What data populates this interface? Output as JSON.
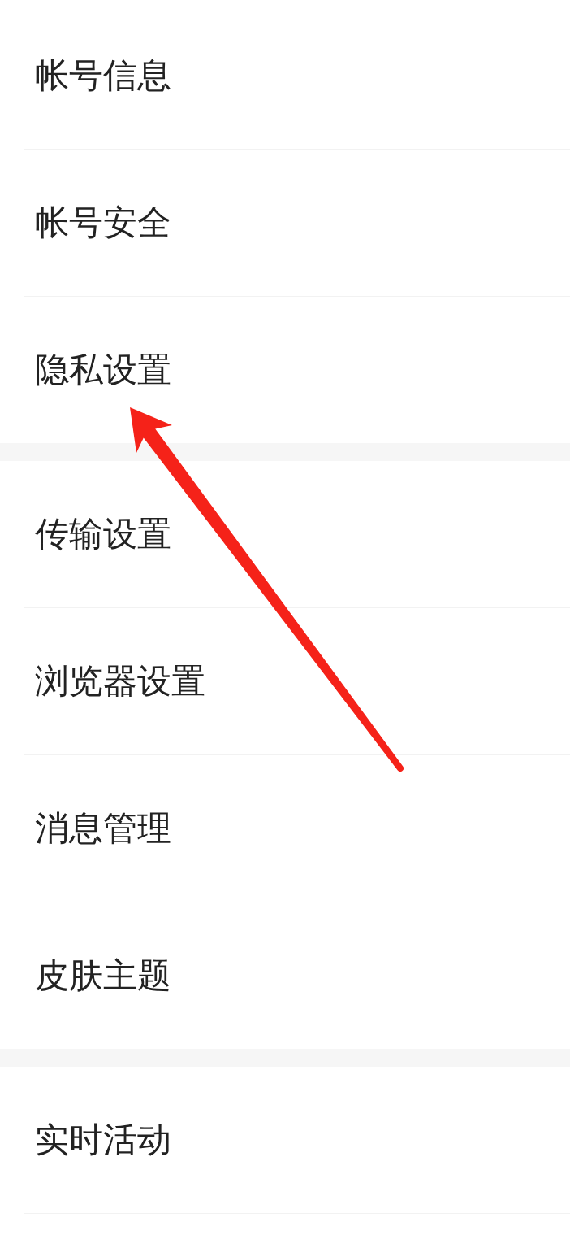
{
  "groups": [
    {
      "items": [
        {
          "label": "帐号信息",
          "marked": false
        },
        {
          "label": "帐号安全",
          "marked": false
        },
        {
          "label": "隐私设置",
          "marked": true
        }
      ]
    },
    {
      "items": [
        {
          "label": "传输设置",
          "marked": false
        },
        {
          "label": "浏览器设置",
          "marked": false
        },
        {
          "label": "消息管理",
          "marked": false
        },
        {
          "label": "皮肤主题",
          "marked": false
        }
      ]
    },
    {
      "items": [
        {
          "label": "实时活动",
          "marked": false
        }
      ]
    }
  ]
}
